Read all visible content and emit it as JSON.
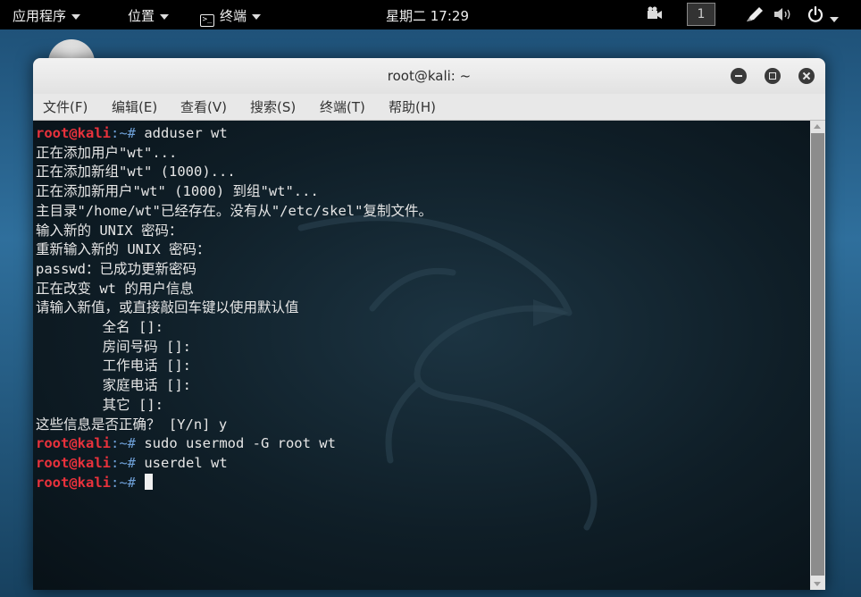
{
  "topbar": {
    "applications": "应用程序",
    "places": "位置",
    "terminal": "终端",
    "clock": "星期二 17:29",
    "workspace": "1"
  },
  "window": {
    "title": "root@kali: ~",
    "menu": [
      "文件(F)",
      "编辑(E)",
      "查看(V)",
      "搜索(S)",
      "终端(T)",
      "帮助(H)"
    ]
  },
  "terminal": {
    "prompt_user": "root@kali",
    "prompt_path": ":~# ",
    "lines": [
      {
        "type": "cmd",
        "text": "adduser wt"
      },
      {
        "type": "out",
        "text": "正在添加用户\"wt\"..."
      },
      {
        "type": "out",
        "text": "正在添加新组\"wt\" (1000)..."
      },
      {
        "type": "out",
        "text": "正在添加新用户\"wt\" (1000) 到组\"wt\"..."
      },
      {
        "type": "out",
        "text": "主目录\"/home/wt\"已经存在。没有从\"/etc/skel\"复制文件。"
      },
      {
        "type": "out",
        "text": "输入新的 UNIX 密码："
      },
      {
        "type": "out",
        "text": "重新输入新的 UNIX 密码："
      },
      {
        "type": "out",
        "text": "passwd：已成功更新密码"
      },
      {
        "type": "out",
        "text": "正在改变 wt 的用户信息"
      },
      {
        "type": "out",
        "text": "请输入新值，或直接敲回车键以使用默认值"
      },
      {
        "type": "out",
        "text": "        全名 []:"
      },
      {
        "type": "out",
        "text": "        房间号码 []:"
      },
      {
        "type": "out",
        "text": "        工作电话 []:"
      },
      {
        "type": "out",
        "text": "        家庭电话 []:"
      },
      {
        "type": "out",
        "text": "        其它 []:"
      },
      {
        "type": "out",
        "text": "这些信息是否正确？ [Y/n] y"
      },
      {
        "type": "cmd",
        "text": "sudo usermod -G root wt"
      },
      {
        "type": "cmd",
        "text": "userdel wt"
      },
      {
        "type": "cursor",
        "text": ""
      }
    ]
  }
}
